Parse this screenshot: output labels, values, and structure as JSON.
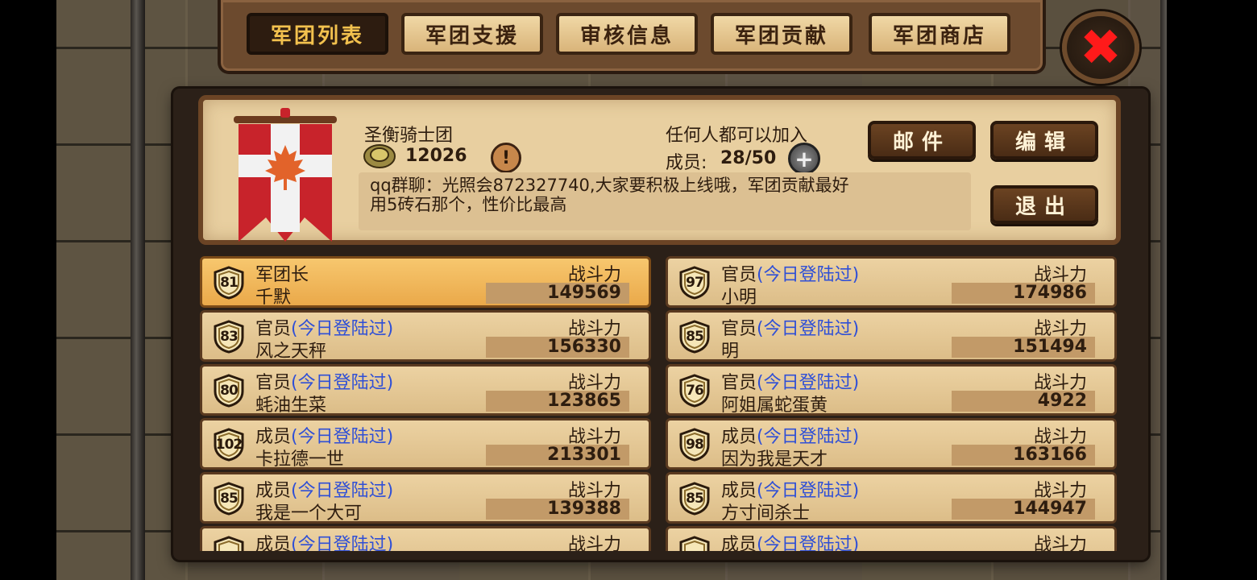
{
  "tabs": [
    {
      "label": "军团列表",
      "active": true
    },
    {
      "label": "军团支援",
      "active": false
    },
    {
      "label": "审核信息",
      "active": false
    },
    {
      "label": "军团贡献",
      "active": false
    },
    {
      "label": "军团商店",
      "active": false
    }
  ],
  "close_icon": "close-x-icon",
  "guild": {
    "name": "圣衡骑士团",
    "points": "12026",
    "join_policy": "任何人都可以加入",
    "members_label": "成员:",
    "members_value": "28/50",
    "notice_line1": "qq群聊：光照会872327740,大家要积极上线哦，军团贡献最好",
    "notice_line2": "用5砖石那个，性价比最高",
    "buttons": {
      "mail": "邮件",
      "edit": "编辑",
      "leave": "退出"
    },
    "banner_colors": {
      "red": "#c8232b",
      "white": "#f2f2f2",
      "leaf": "#e2632a"
    }
  },
  "members": [
    {
      "level": "81",
      "rank": "军团长",
      "login": "",
      "name": "千默",
      "power_label": "战斗力",
      "power": "149569",
      "highlight": true
    },
    {
      "level": "97",
      "rank": "官员",
      "login": "(今日登陆过)",
      "name": "小明",
      "power_label": "战斗力",
      "power": "174986",
      "highlight": false
    },
    {
      "level": "83",
      "rank": "官员",
      "login": "(今日登陆过)",
      "name": "风之天秤",
      "power_label": "战斗力",
      "power": "156330",
      "highlight": false
    },
    {
      "level": "85",
      "rank": "官员",
      "login": "(今日登陆过)",
      "name": "明",
      "power_label": "战斗力",
      "power": "151494",
      "highlight": false
    },
    {
      "level": "80",
      "rank": "官员",
      "login": "(今日登陆过)",
      "name": "蚝油生菜",
      "power_label": "战斗力",
      "power": "123865",
      "highlight": false
    },
    {
      "level": "76",
      "rank": "官员",
      "login": "(今日登陆过)",
      "name": "阿姐属蛇蛋黄",
      "power_label": "战斗力",
      "power": "4922",
      "highlight": false
    },
    {
      "level": "102",
      "rank": "成员",
      "login": "(今日登陆过)",
      "name": "卡拉德一世",
      "power_label": "战斗力",
      "power": "213301",
      "highlight": false
    },
    {
      "level": "98",
      "rank": "成员",
      "login": "(今日登陆过)",
      "name": "因为我是天才",
      "power_label": "战斗力",
      "power": "163166",
      "highlight": false
    },
    {
      "level": "85",
      "rank": "成员",
      "login": "(今日登陆过)",
      "name": "我是一个大可",
      "power_label": "战斗力",
      "power": "139388",
      "highlight": false
    },
    {
      "level": "85",
      "rank": "成员",
      "login": "(今日登陆过)",
      "name": "方寸间杀士",
      "power_label": "战斗力",
      "power": "144947",
      "highlight": false
    },
    {
      "level": "",
      "rank": "成员",
      "login": "(今日登陆过)",
      "name": "",
      "power_label": "战斗力",
      "power": "",
      "highlight": false
    },
    {
      "level": "",
      "rank": "成员",
      "login": "(今日登陆过)",
      "name": "",
      "power_label": "战斗力",
      "power": "",
      "highlight": false
    }
  ]
}
